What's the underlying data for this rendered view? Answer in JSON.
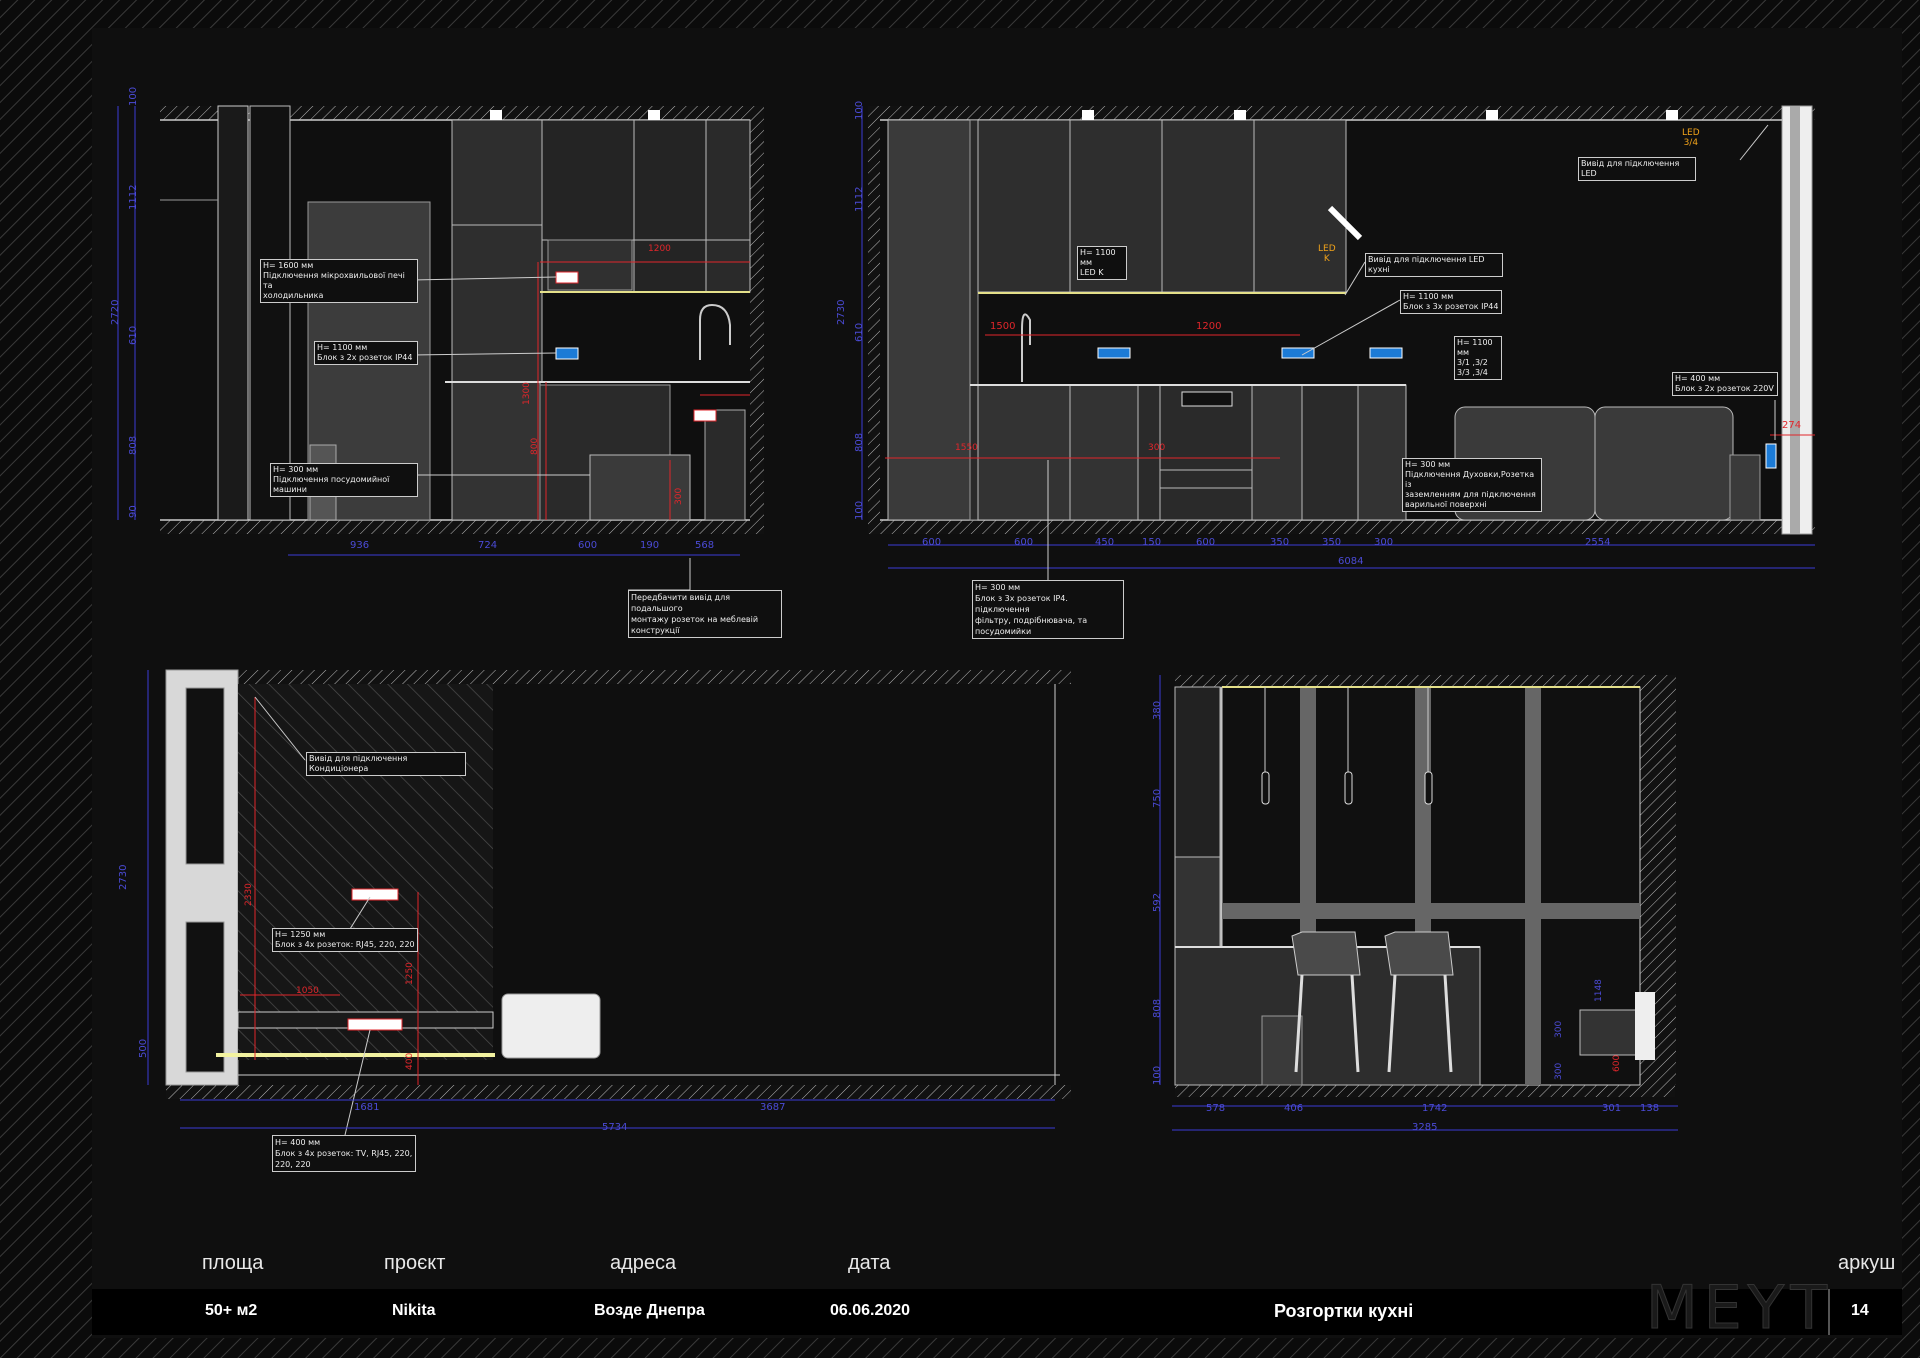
{
  "colors": {
    "background": "#0d0d0d",
    "hatch": "#2b2b2b",
    "lines": "#cfcfcf",
    "dimension": "#3b3bd6",
    "red": "#e0262b",
    "accent": "#f0a21a",
    "socket": "#1c7bd6",
    "highlight": "#f2f2a0"
  },
  "elevation1": {
    "notes": [
      [
        "H= 1600 мм",
        "Підключення мікрохвильової печі та",
        "холодильника"
      ],
      [
        "H= 1100 мм",
        "Блок з 2х розеток IP44"
      ],
      [
        "H= 300 мм",
        "Підключення посудомийної машини"
      ],
      [
        "Передбачити вивід для подальшого",
        "монтажу розеток на меблевій",
        "конструкції"
      ]
    ],
    "vdims": [
      "100",
      "1112",
      "610",
      "808",
      "90",
      "2720"
    ],
    "hdims": [
      "936",
      "724",
      "600",
      "190",
      "568"
    ],
    "red_dims": [
      "1200",
      "1300",
      "800",
      "300"
    ]
  },
  "elevation2": {
    "notes": [
      [
        "Вивід для підключення LED"
      ],
      [
        "H= 1100 мм",
        "LED K"
      ],
      [
        "Вивід для підключення LED кухні"
      ],
      [
        "H= 1100 мм",
        "Блок з 3х розеток IP44"
      ],
      [
        "H= 1100 мм",
        "3/1 ,3/2",
        "3/3 ,3/4"
      ],
      [
        "H= 400 мм",
        "Блок з 2х розеток 220V"
      ],
      [
        "H= 300 мм",
        "Підключення Духовки,Розетка із",
        "заземленням для підключення",
        "варильної поверхні"
      ],
      [
        "H= 300 мм",
        "Блок з 3х розеток IP4. підключення",
        "фільтру, подрібнювача, та",
        "посудомийки"
      ]
    ],
    "led_tags": [
      [
        "LED",
        "3/4"
      ],
      [
        "LED",
        "K"
      ]
    ],
    "vdims": [
      "100",
      "1112",
      "610",
      "808",
      "100",
      "2730"
    ],
    "hdims": [
      "600",
      "600",
      "450",
      "150",
      "600",
      "350",
      "350",
      "300",
      "2554"
    ],
    "total": "6084",
    "red_dims": [
      "1500",
      "1200",
      "1550",
      "300",
      "274"
    ]
  },
  "elevation3": {
    "notes": [
      [
        "Вивід для підключення Кондиціонера"
      ],
      [
        "H= 1250 мм",
        "Блок з 4х розеток: RJ45, 220, 220"
      ],
      [
        "H= 400 мм",
        "Блок з 4х розеток: TV, RJ45, 220,",
        "220, 220"
      ]
    ],
    "vdims": [
      "2730",
      "500"
    ],
    "hdims": [
      "1681",
      "3687"
    ],
    "total": "5734",
    "red_dims": [
      "2330",
      "1250",
      "1050",
      "400"
    ]
  },
  "elevation4": {
    "vdims": [
      "380",
      "750",
      "592",
      "808",
      "100"
    ],
    "hdims": [
      "578",
      "406",
      "1742",
      "301",
      "138"
    ],
    "total": "3285",
    "side_dims": [
      "1148",
      "300",
      "300",
      "600"
    ]
  },
  "titleblock": {
    "labels": {
      "area": "площа",
      "project": "проєкт",
      "address": "адреса",
      "date": "дата",
      "sheet": "аркуш"
    },
    "values": {
      "area": "50+ м2",
      "project": "Nikita",
      "address": "Возде Днепра",
      "date": "06.06.2020",
      "title": "Розгортки кухні",
      "sheet": "14"
    },
    "logo": "MEYT"
  }
}
